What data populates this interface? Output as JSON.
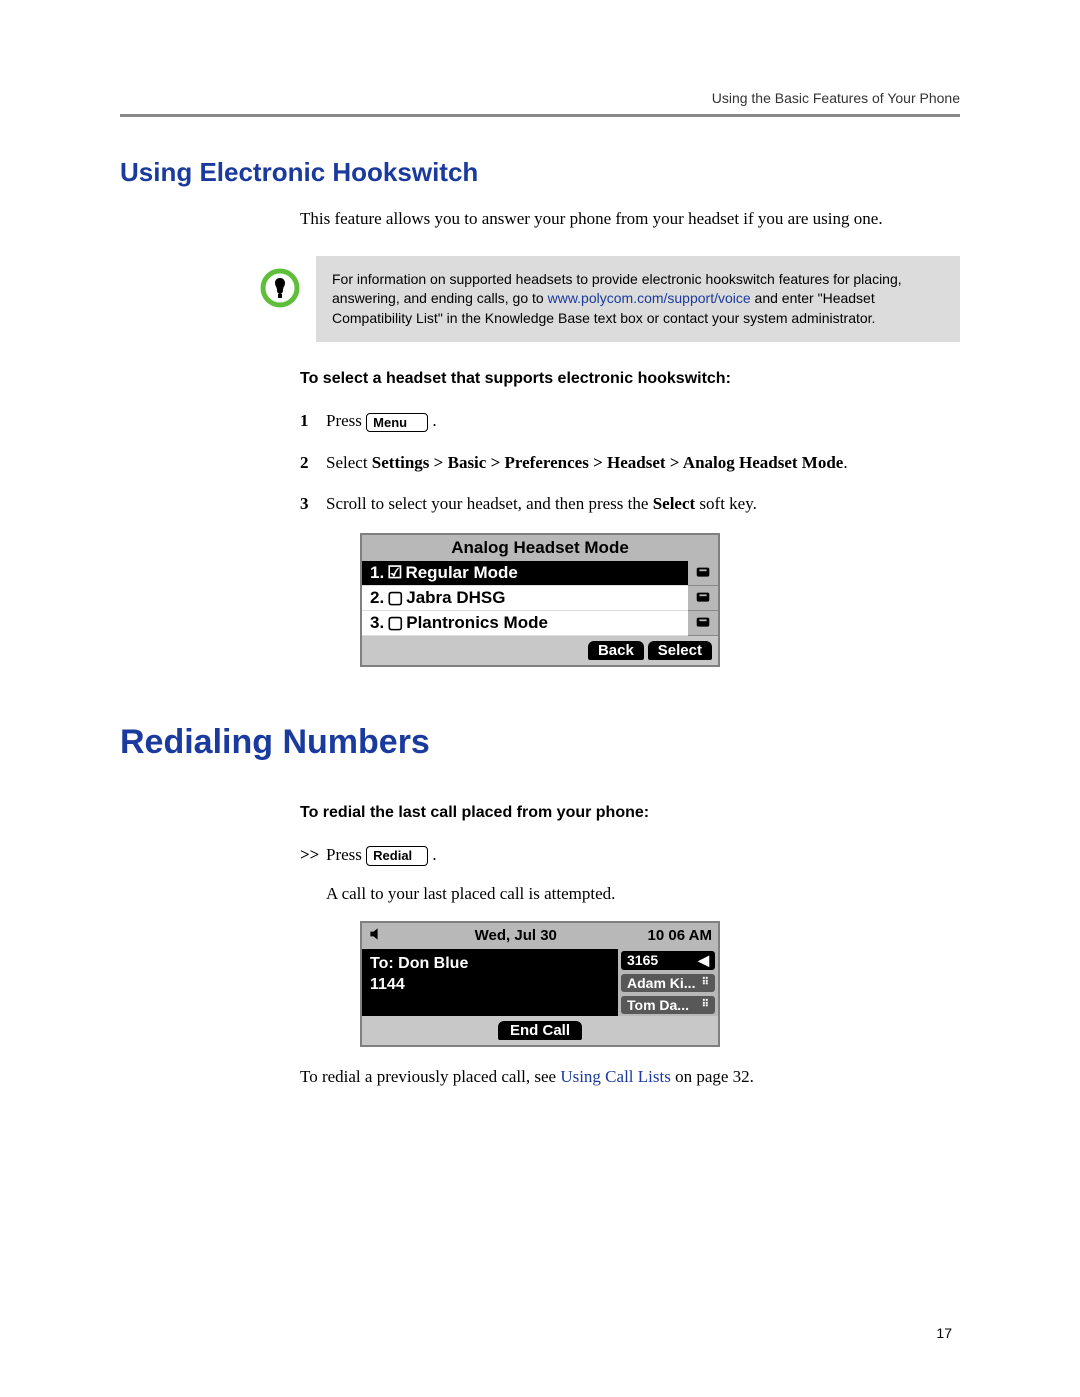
{
  "header": "Using the Basic Features of Your Phone",
  "page_number": "17",
  "section1": {
    "heading": "Using Electronic Hookswitch",
    "intro": "This feature allows you to answer your phone from your headset if you are using one.",
    "note_pre": "For information on supported headsets to provide electronic hookswitch features for placing, answering, and ending calls, go to ",
    "note_link": "www.polycom.com/support/voice",
    "note_post": " and enter \"Headset Compatibility List\" in the Knowledge Base text box or contact your system administrator.",
    "subheading": "To select a headset that supports electronic hookswitch:",
    "steps": {
      "s1_pre": "Press ",
      "s1_button": "Menu",
      "s1_post": " .",
      "s2_pre": "Select ",
      "s2_bold": "Settings > Basic > Preferences > Headset > Analog Headset Mode",
      "s2_post": ".",
      "s3_pre": "Scroll to select your headset, and then press the ",
      "s3_bold": "Select",
      "s3_post": " soft key."
    },
    "screenshot": {
      "title": "Analog Headset Mode",
      "item1": "Regular Mode",
      "item1_num": "1.",
      "item2": "Jabra DHSG",
      "item2_num": "2.",
      "item3": "Plantronics Mode",
      "item3_num": "3.",
      "btn_back": "Back",
      "btn_select": "Select"
    }
  },
  "section2": {
    "heading": "Redialing Numbers",
    "subheading": "To redial the last call placed from your phone:",
    "arrow": ">>",
    "step_pre": "Press ",
    "step_button": "Redial",
    "step_post": " .",
    "result": "A call to your last placed call is attempted.",
    "screenshot": {
      "date": "Wed, Jul 30",
      "time": "10 06 AM",
      "to_label": "To: Don Blue",
      "number": "1144",
      "pill1": "3165",
      "pill2": "Adam Ki...",
      "pill3": "Tom Da...",
      "btn_end": "End Call"
    },
    "footer_pre": "To redial a previously placed call, see ",
    "footer_link": "Using Call Lists",
    "footer_post": " on page 32."
  }
}
